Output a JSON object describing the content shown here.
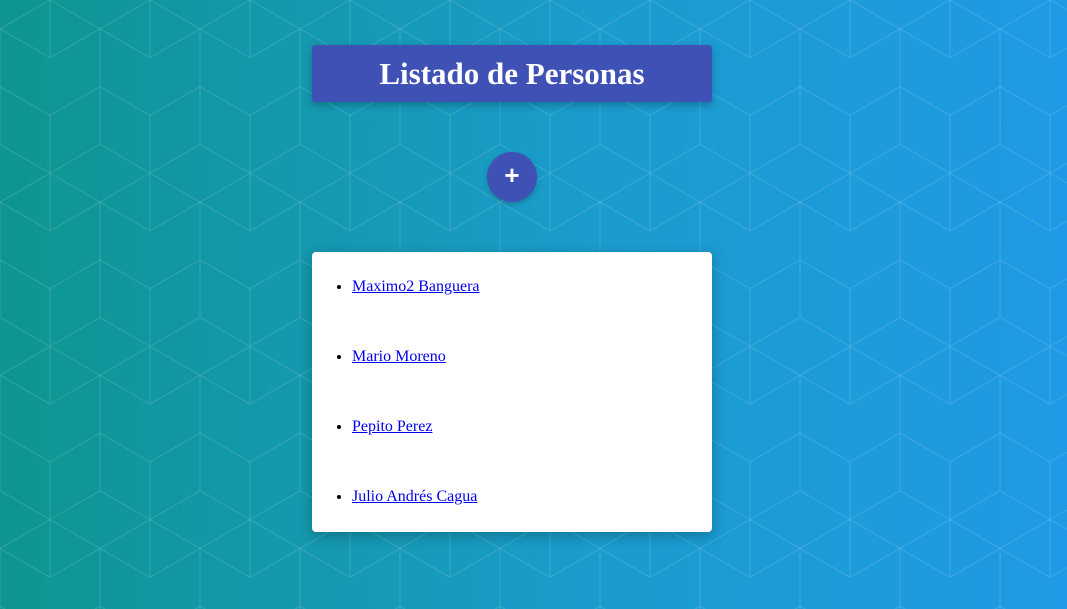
{
  "header": {
    "title": "Listado de Personas"
  },
  "actions": {
    "add_label": "+"
  },
  "people": [
    "Maximo2 Banguera",
    "Mario Moreno",
    "Pepito Perez",
    "Julio Andrés Cagua"
  ],
  "colors": {
    "accent": "#3f51b5",
    "background_start": "#0e9590",
    "background_end": "#209ae6",
    "link": "#0000ee"
  }
}
